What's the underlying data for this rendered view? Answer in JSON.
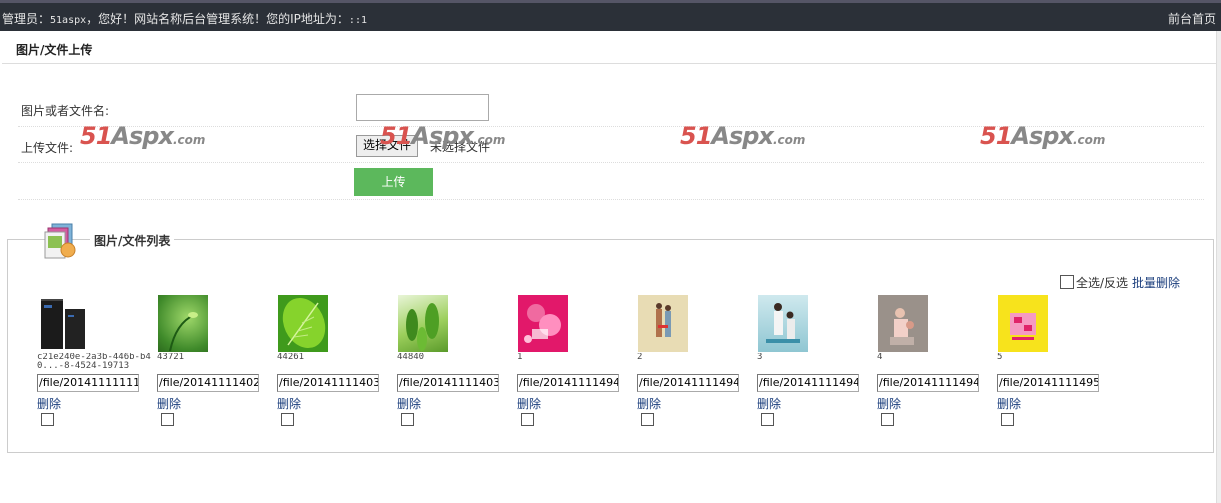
{
  "topbar": {
    "greeting_prefix": "管理员：",
    "username": "51aspx",
    "greeting_middle": "，您好！网站名称后台管理系统！您的IP地址为：",
    "ip": "::1",
    "home_link": "前台首页"
  },
  "upload_panel": {
    "title": "图片/文件上传",
    "name_label": "图片或者文件名:",
    "name_value": "",
    "file_label": "上传文件:",
    "choose_file_button": "选择文件",
    "no_file_text": "未选择文件",
    "upload_button": "上传"
  },
  "watermarks": [
    {
      "num": "51",
      "mark": "Aspx",
      "suffix": ".com"
    },
    {
      "num": "51",
      "mark": "Aspx",
      "suffix": ".com"
    },
    {
      "num": "51",
      "mark": "Aspx",
      "suffix": ".com"
    },
    {
      "num": "51",
      "mark": "Aspx",
      "suffix": ".com"
    }
  ],
  "file_list": {
    "title": "图片/文件列表",
    "select_all_label": "全选/反选",
    "batch_delete_link": "批量删除",
    "delete_label": "删除",
    "items": [
      {
        "name": "c21e240e-2a3b-446b-b40...-8-4524-19713",
        "path": "/file/20141111111",
        "thumb": "server"
      },
      {
        "name": "43721",
        "path": "/file/20141111402",
        "thumb": "green-bokeh"
      },
      {
        "name": "44261",
        "path": "/file/20141111403",
        "thumb": "green-leaf"
      },
      {
        "name": "44840",
        "path": "/file/20141111403",
        "thumb": "green-leaves"
      },
      {
        "name": "1",
        "path": "/file/20141111494",
        "thumb": "pink-poster"
      },
      {
        "name": "2",
        "path": "/file/20141111494",
        "thumb": "beige-poster"
      },
      {
        "name": "3",
        "path": "/file/20141111494",
        "thumb": "teal-poster"
      },
      {
        "name": "4",
        "path": "/file/20141111494",
        "thumb": "grey-poster"
      },
      {
        "name": "5",
        "path": "/file/20141111495",
        "thumb": "yellow-poster"
      }
    ]
  },
  "colors": {
    "topbar": "#2b3038",
    "upload_button": "#5cb85c",
    "link": "#1a3d7c",
    "watermark_red": "#d9534f"
  }
}
